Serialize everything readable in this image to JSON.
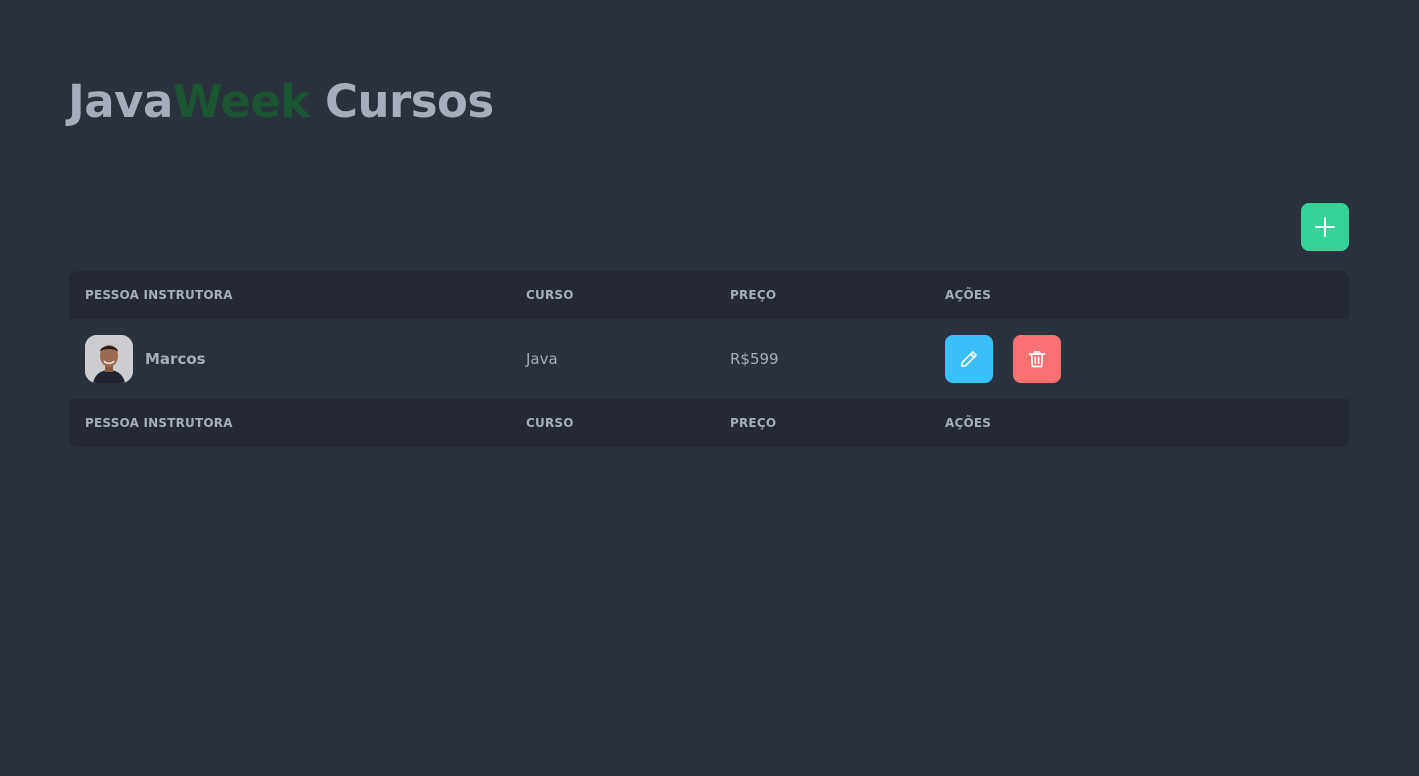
{
  "header": {
    "title_part1": "Java",
    "title_accent": "Week",
    "title_part2": " Cursos"
  },
  "toolbar": {
    "add_icon": "plus-icon"
  },
  "table": {
    "columns": [
      "PESSOA INSTRUTORA",
      "CURSO",
      "PREÇO",
      "AÇÕES"
    ],
    "rows": [
      {
        "instructor": "Marcos",
        "course": "Java",
        "price": "R$599",
        "actions": [
          "pencil-icon",
          "trash-icon"
        ]
      }
    ],
    "footer": [
      "PESSOA INSTRUTORA",
      "CURSO",
      "PREÇO",
      "AÇÕES"
    ]
  },
  "colors": {
    "background": "#2a303c",
    "header_bg": "#242933",
    "text": "#a6adbb",
    "accent_green": "#1a5430",
    "add_button": "#36d399",
    "edit_button": "#3abff8",
    "delete_button": "#f87272"
  }
}
